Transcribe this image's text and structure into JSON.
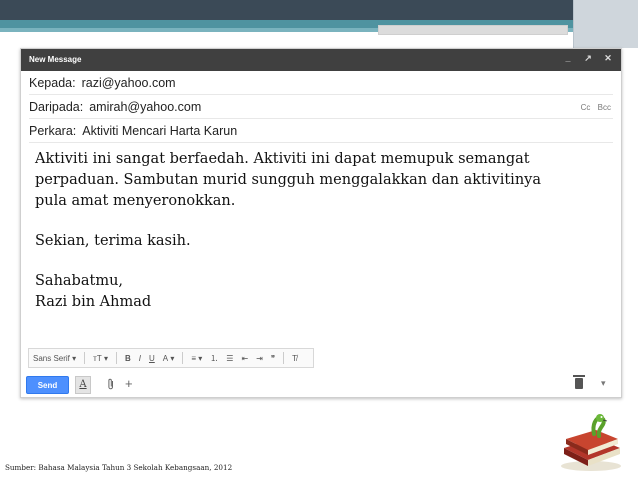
{
  "compose": {
    "title": "New Message",
    "controls": [
      "_",
      "↗",
      "✕"
    ],
    "to_label": "Kepada:",
    "to_value": "razi@yahoo.com",
    "from_label": "Daripada:",
    "from_value": "amirah@yahoo.com",
    "cc": "Cc",
    "bcc": "Bcc",
    "subject_label": "Perkara:",
    "subject_value": "Aktiviti Mencari Harta Karun",
    "body": {
      "para1_line1": "Aktiviti ini sangat berfaedah. Aktiviti ini dapat memupuk semangat",
      "para1_line2": "perpaduan. Sambutan murid sungguh menggalakkan dan aktivitinya",
      "para1_line3": "pula amat menyeronokkan.",
      "closing": "Sekian, terima kasih.",
      "signoff": "Sahabatmu,",
      "name": "Razi bin Ahmad"
    },
    "format_toolbar": {
      "font": "Sans Serif",
      "size": "тT",
      "bold": "B",
      "italic": "I",
      "underline": "U",
      "text_color": "A",
      "align": "≡",
      "numbered_list": "⒈",
      "bullet_list": "☰",
      "indent_less": "⇤",
      "indent_more": "⇥",
      "quote": "❞",
      "clear_format": "T̸"
    },
    "send_label": "Send",
    "format_label": "A",
    "attach_icon": "paperclip-icon",
    "insert_icon": "plus-icon",
    "discard_icon": "trash-icon",
    "more_label": "▾"
  },
  "source": "Sumber: Bahasa Malaysia Tahun 3 Sekolah Kebangsaan, 2012",
  "colors": {
    "header_dark": "#3b4a57",
    "header_accent": "#4f93a0",
    "compose_title": "#404040",
    "send_button": "#4d90fe"
  }
}
